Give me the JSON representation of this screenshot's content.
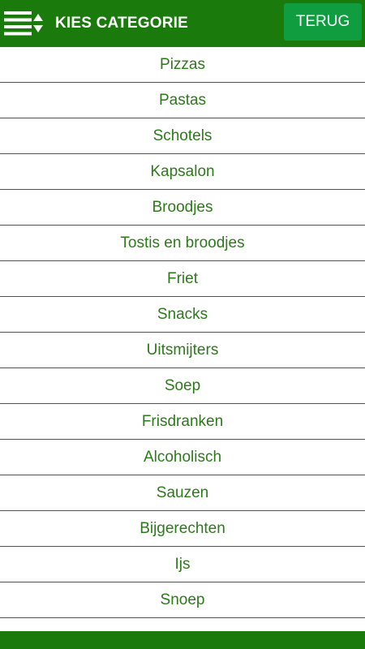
{
  "header": {
    "title": "KIES CATEGORIE",
    "back_label": "TERUG",
    "menu_icon": "list-sort-icon",
    "background_color": "#1a7a0c",
    "button_color": "#0f9d3f"
  },
  "categories": [
    "Pizzas",
    "Pastas",
    "Schotels",
    "Kapsalon",
    "Broodjes",
    "Tostis en broodjes",
    "Friet",
    "Snacks",
    "Uitsmijters",
    "Soep",
    "Frisdranken",
    "Alcoholisch",
    "Sauzen",
    "Bijgerechten",
    "Ijs",
    "Snoep"
  ],
  "colors": {
    "text": "#2c7a1a",
    "divider": "#1a7a0c"
  }
}
